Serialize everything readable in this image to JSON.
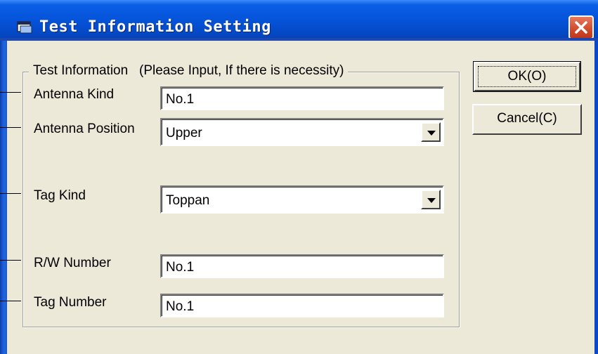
{
  "window": {
    "title": "Test Information Setting",
    "icon": "app-window-icon",
    "close_icon": "close-icon"
  },
  "group": {
    "caption": "Test Information   (Please Input, If there is necessity)"
  },
  "fields": {
    "antenna_kind": {
      "label": "Antenna Kind",
      "value": "No.1"
    },
    "antenna_position": {
      "label": "Antenna Position",
      "value": "Upper"
    },
    "tag_kind": {
      "label": "Tag Kind",
      "value": "Toppan"
    },
    "rw_number": {
      "label": "R/W Number",
      "value": "No.1"
    },
    "tag_number": {
      "label": "Tag Number",
      "value": "No.1"
    }
  },
  "buttons": {
    "ok": "OK(O)",
    "cancel": "Cancel(C)"
  },
  "colors": {
    "titlebar": "#0553d9",
    "face": "#ece9d8",
    "close": "#d14a2c"
  }
}
